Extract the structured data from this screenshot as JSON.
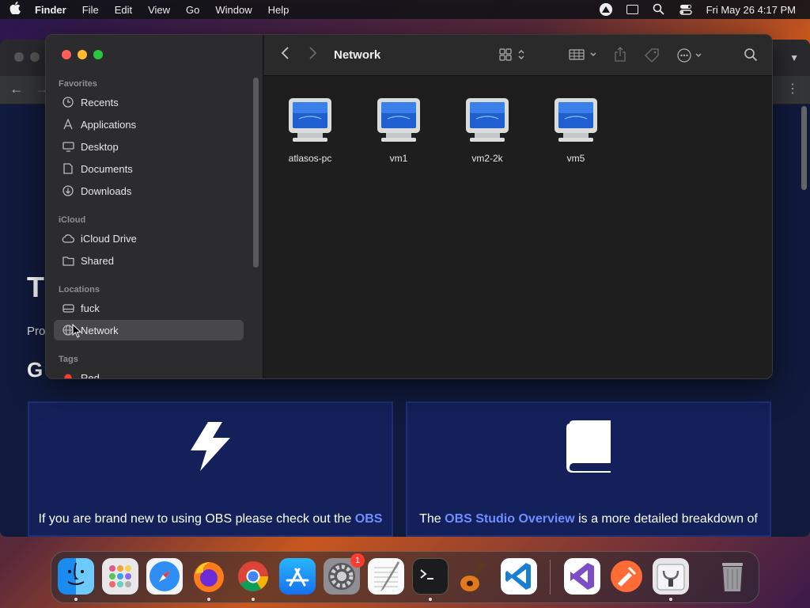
{
  "menubar": {
    "app_name": "Finder",
    "menus": [
      "File",
      "Edit",
      "View",
      "Go",
      "Window",
      "Help"
    ],
    "clock": "Fri May 26  4:17 PM"
  },
  "browser": {
    "title_fragment": "T",
    "text_fragment": "Pro",
    "heading_fragment": "G",
    "cards": [
      {
        "text_before": "If you are brand new to using OBS please check out the ",
        "link": "OBS",
        "text_after": ""
      },
      {
        "text_before": "The ",
        "link": "OBS Studio Overview",
        "text_after": " is a more detailed breakdown of"
      }
    ]
  },
  "finder": {
    "title": "Network",
    "sidebar": {
      "sections": [
        {
          "label": "Favorites",
          "items": [
            {
              "label": "Recents",
              "icon": "clock-icon"
            },
            {
              "label": "Applications",
              "icon": "applications-icon"
            },
            {
              "label": "Desktop",
              "icon": "desktop-icon"
            },
            {
              "label": "Documents",
              "icon": "document-icon"
            },
            {
              "label": "Downloads",
              "icon": "downloads-icon"
            }
          ]
        },
        {
          "label": "iCloud",
          "items": [
            {
              "label": "iCloud Drive",
              "icon": "cloud-icon"
            },
            {
              "label": "Shared",
              "icon": "shared-folder-icon"
            }
          ]
        },
        {
          "label": "Locations",
          "items": [
            {
              "label": "fuck",
              "icon": "disk-icon"
            },
            {
              "label": "Network",
              "icon": "globe-icon",
              "selected": true
            }
          ]
        },
        {
          "label": "Tags",
          "items": [
            {
              "label": "Red",
              "icon": "red-tag-dot",
              "color": "#ff3b30"
            }
          ]
        }
      ]
    },
    "items": [
      {
        "label": "atlasos-pc",
        "icon": "computer-icon"
      },
      {
        "label": "vm1",
        "icon": "computer-icon"
      },
      {
        "label": "vm2-2k",
        "icon": "computer-icon"
      },
      {
        "label": "vm5",
        "icon": "computer-icon"
      }
    ]
  },
  "dock": {
    "apps": [
      "Finder",
      "Launchpad",
      "Safari",
      "Firefox",
      "Chrome",
      "App Store",
      "System Settings",
      "TextEdit",
      "Terminal",
      "GarageBand",
      "Visual Studio Code",
      "Visual Studio",
      "Postman",
      "Disk Utility",
      "Trash"
    ],
    "settings_badge": "1"
  },
  "colors": {
    "accent_link": "#6f8dff",
    "sidebar_bg": "#2c2c2e",
    "content_bg": "#1e1e1e"
  }
}
